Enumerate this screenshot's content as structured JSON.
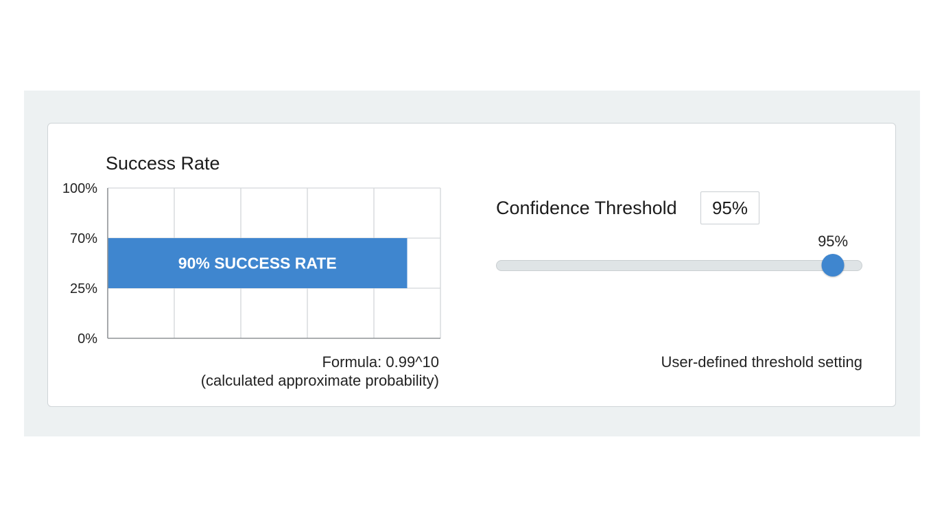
{
  "chart_data": {
    "type": "bar",
    "orientation": "horizontal",
    "title": "Success Rate",
    "y_ticks": [
      "0%",
      "25%",
      "70%",
      "100%"
    ],
    "bar": {
      "label": "90% SUCCESS RATE",
      "value": 0.9,
      "band": [
        "25%",
        "70%"
      ]
    },
    "grid": true,
    "vertical_gridlines": 5,
    "color": "#3f86cf"
  },
  "formula": {
    "line1": "Formula: 0.99^10",
    "line2": "(calculated approximate probability)"
  },
  "threshold": {
    "label": "Confidence Threshold",
    "input_value": "95%",
    "slider_value_label": "95%",
    "slider_value": 0.95,
    "caption": "User-defined threshold setting",
    "accent_color": "#3f86cf"
  }
}
